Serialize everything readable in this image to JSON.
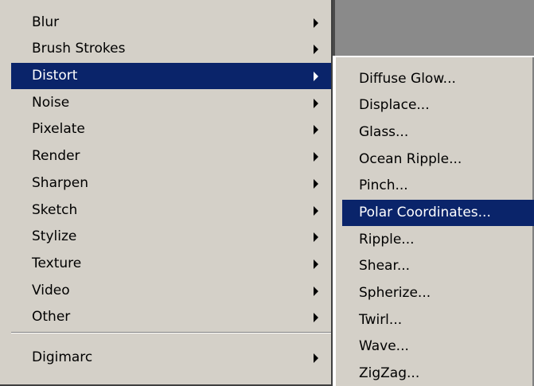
{
  "main_menu": {
    "items": [
      {
        "label": "Blur"
      },
      {
        "label": "Brush Strokes"
      },
      {
        "label": "Distort",
        "selected": true
      },
      {
        "label": "Noise"
      },
      {
        "label": "Pixelate"
      },
      {
        "label": "Render"
      },
      {
        "label": "Sharpen"
      },
      {
        "label": "Sketch"
      },
      {
        "label": "Stylize"
      },
      {
        "label": "Texture"
      },
      {
        "label": "Video"
      },
      {
        "label": "Other"
      },
      {
        "label": "Digimarc"
      }
    ]
  },
  "submenu": {
    "items": [
      {
        "label": "Diffuse Glow..."
      },
      {
        "label": "Displace..."
      },
      {
        "label": "Glass..."
      },
      {
        "label": "Ocean Ripple..."
      },
      {
        "label": "Pinch..."
      },
      {
        "label": "Polar Coordinates...",
        "selected": true
      },
      {
        "label": "Ripple..."
      },
      {
        "label": "Shear..."
      },
      {
        "label": "Spherize..."
      },
      {
        "label": "Twirl..."
      },
      {
        "label": "Wave..."
      },
      {
        "label": "ZigZag..."
      }
    ]
  },
  "colors": {
    "menu_bg": "#d4d0c8",
    "highlight": "#0a246a",
    "workspace": "#8a8a8a"
  }
}
